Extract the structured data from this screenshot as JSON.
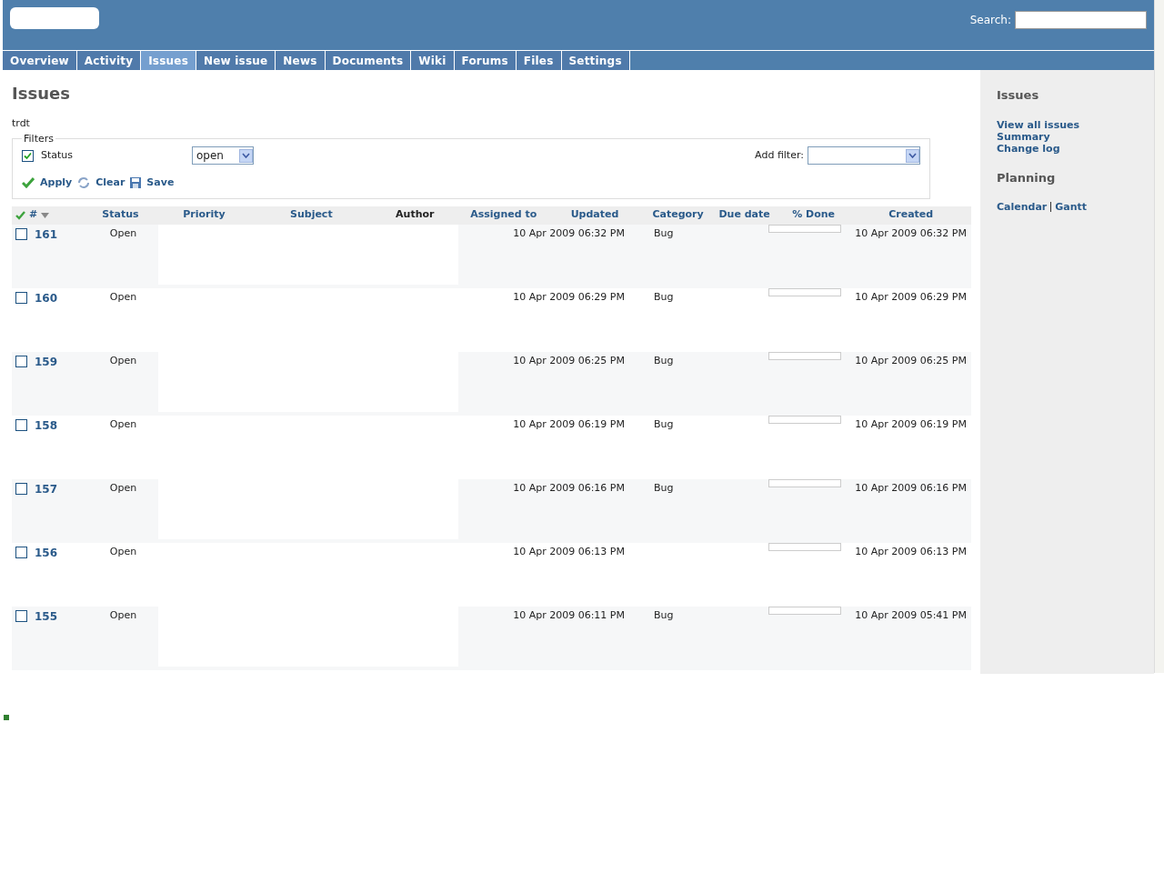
{
  "header": {
    "search_label": "Search:"
  },
  "tabs": [
    {
      "label": "Overview",
      "selected": false
    },
    {
      "label": "Activity",
      "selected": false
    },
    {
      "label": "Issues",
      "selected": true
    },
    {
      "label": "New issue",
      "selected": false
    },
    {
      "label": "News",
      "selected": false
    },
    {
      "label": "Documents",
      "selected": false
    },
    {
      "label": "Wiki",
      "selected": false
    },
    {
      "label": "Forums",
      "selected": false
    },
    {
      "label": "Files",
      "selected": false
    },
    {
      "label": "Settings",
      "selected": false
    }
  ],
  "title": "Issues",
  "query_name": "trdt",
  "filters": {
    "legend": "Filters",
    "items": [
      {
        "label": "Status",
        "checked": true,
        "value": "open"
      }
    ],
    "add_filter_label": "Add filter:",
    "actions": [
      "Apply",
      "Clear",
      "Save"
    ]
  },
  "table": {
    "columns": [
      {
        "label": "#",
        "sortable": true
      },
      {
        "label": "Status",
        "sortable": true
      },
      {
        "label": "Priority",
        "sortable": true
      },
      {
        "label": "Subject",
        "sortable": true
      },
      {
        "label": "Author",
        "sortable": false
      },
      {
        "label": "Assigned to",
        "sortable": true
      },
      {
        "label": "Updated",
        "sortable": true
      },
      {
        "label": "Category",
        "sortable": true
      },
      {
        "label": "Due date",
        "sortable": true
      },
      {
        "label": "% Done",
        "sortable": true
      },
      {
        "label": "Created",
        "sortable": true
      }
    ],
    "rows": [
      {
        "id": "161",
        "checked": false,
        "status": "Open",
        "updated": "10 Apr 2009 06:32 PM",
        "category": "Bug",
        "level": 0,
        "created": "10 Apr 2009 06:32 PM"
      },
      {
        "id": "160",
        "checked": false,
        "status": "Open",
        "updated": "10 Apr 2009 06:29 PM",
        "category": "Bug",
        "level": 0,
        "created": "10 Apr 2009 06:29 PM"
      },
      {
        "id": "159",
        "checked": false,
        "status": "Open",
        "updated": "10 Apr 2009 06:25 PM",
        "category": "Bug",
        "level": 0,
        "created": "10 Apr 2009 06:25 PM"
      },
      {
        "id": "158",
        "checked": false,
        "status": "Open",
        "updated": "10 Apr 2009 06:19 PM",
        "category": "Bug",
        "level": 0,
        "created": "10 Apr 2009 06:19 PM"
      },
      {
        "id": "157",
        "checked": false,
        "status": "Open",
        "updated": "10 Apr 2009 06:16 PM",
        "category": "Bug",
        "level": 0,
        "created": "10 Apr 2009 06:16 PM"
      },
      {
        "id": "156",
        "checked": false,
        "status": "Open",
        "updated": "10 Apr 2009 06:13 PM",
        "level": 0,
        "created": "10 Apr 2009 06:13 PM"
      },
      {
        "id": "155",
        "checked": false,
        "status": "Open",
        "updated": "10 Apr 2009 06:11 PM",
        "category": "Bug",
        "level": 0,
        "created": "10 Apr 2009 05:41 PM"
      }
    ]
  },
  "sidebar": {
    "sections": [
      {
        "heading": "Issues",
        "links": [
          [
            "View all issues"
          ],
          [
            "Summary"
          ],
          [
            "Change log"
          ]
        ]
      },
      {
        "heading": "Planning",
        "links": [
          [
            "Calendar",
            "Gantt"
          ]
        ]
      }
    ]
  }
}
